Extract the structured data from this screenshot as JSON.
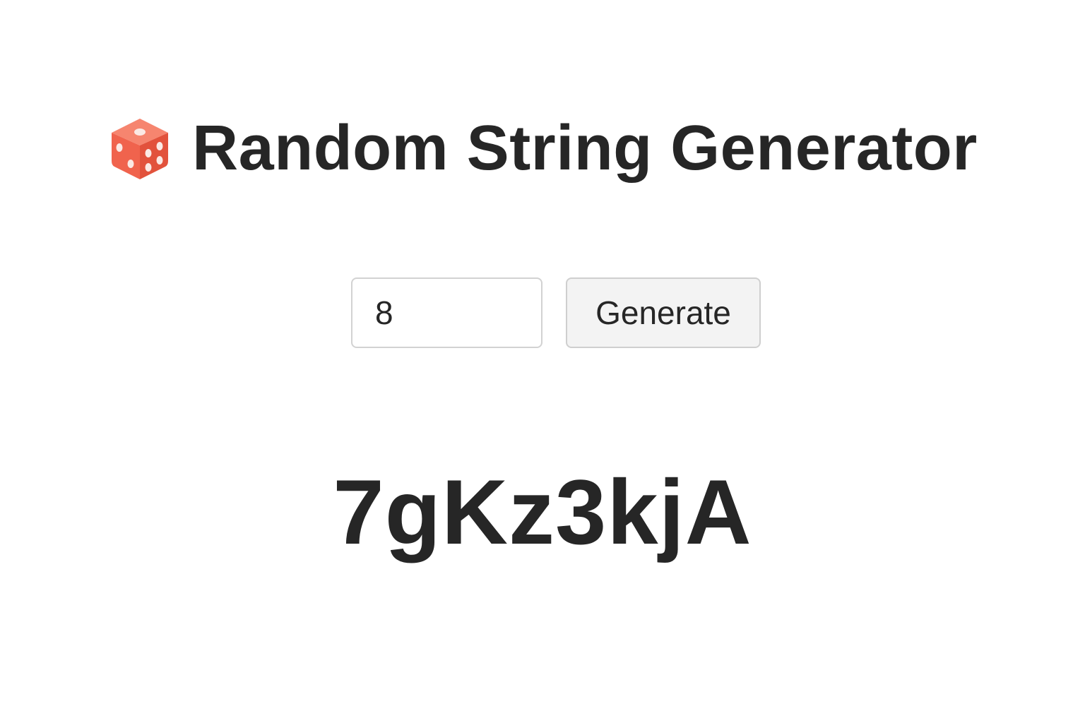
{
  "header": {
    "icon": "dice-icon",
    "title": "Random String Generator"
  },
  "controls": {
    "length_value": "8",
    "generate_label": "Generate"
  },
  "result": {
    "value": "7gKz3kjA"
  },
  "colors": {
    "die_face": "#f0634d",
    "text": "#262626",
    "button_bg": "#f3f3f3",
    "border": "#d2d2d2"
  }
}
